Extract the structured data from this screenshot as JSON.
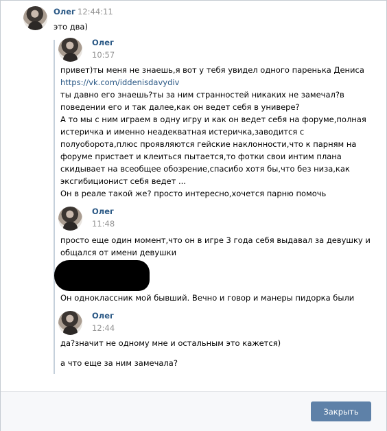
{
  "top_message": {
    "author": "Олег",
    "time": "12:44:11",
    "text": "это два)"
  },
  "forwarded": [
    {
      "author": "Олег",
      "time": "10:57",
      "lines": [
        "привет)ты меня не знаешь,я вот у тебя увидел одного паренька Дениса",
        "https://vk.com/iddenisdavydiv",
        "ты давно его знаешь?ты за ним странностей никаких не замечал?в",
        "поведении его и так далее,как он ведет себя в универе?",
        "А то мы с ним играем в одну игру и как он ведет себя на форуме,полная",
        "истеричка и именно неадекватная истеричка,заводится с",
        "полуоборота,плюс проявляются гейские наклонности,что к парням на",
        "форуме пристает и клеиться пытается,то фотки свои интим плана",
        "скидывает на всеобщее обозрение,спасибо хотя бы,что без низа,как",
        "эксгибиционист себя ведет ...",
        "Он в реале такой же? просто интересно,хочется парню помочь"
      ]
    },
    {
      "author": "Олег",
      "time": "11:48",
      "lines": [
        "просто еще один момент,что он в игре 3 года себя выдавал за девушку и",
        "общался от имени девушки"
      ],
      "reply": "Он одноклассник мой бывший. Вечно и говор и манеры пидорка были"
    },
    {
      "author": "Олег",
      "time": "12:44",
      "lines": [
        "да?значит не одному мне и остальным это кажется)"
      ],
      "extra": "а что еще за ним замечала?"
    }
  ],
  "footer": {
    "close_label": "Закрыть"
  }
}
